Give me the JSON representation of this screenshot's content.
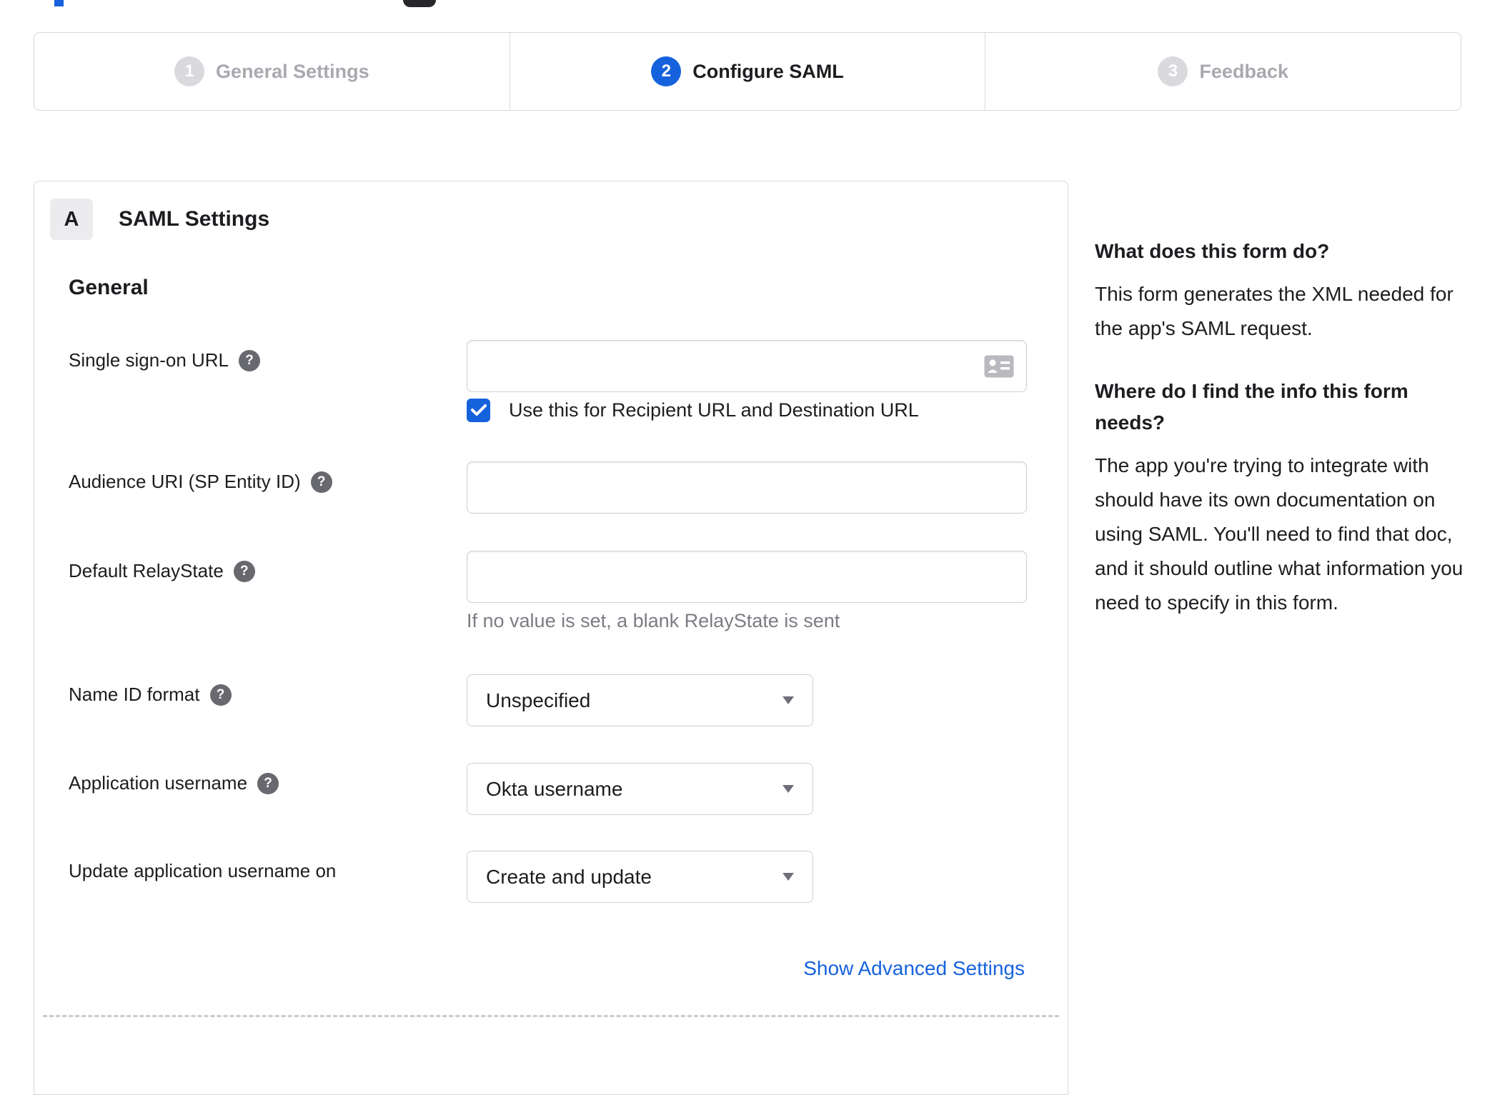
{
  "stepper": {
    "steps": [
      {
        "number": "1",
        "label": "General Settings",
        "state": "inactive"
      },
      {
        "number": "2",
        "label": "Configure SAML",
        "state": "active"
      },
      {
        "number": "3",
        "label": "Feedback",
        "state": "inactive"
      }
    ]
  },
  "form": {
    "badge": "A",
    "section_title": "SAML Settings",
    "group_title": "General",
    "fields": [
      {
        "label": "Single sign-on URL",
        "type": "text",
        "value": ""
      },
      {
        "label": "Audience URI (SP Entity ID)",
        "type": "text",
        "value": ""
      },
      {
        "label": "Default RelayState",
        "type": "text",
        "value": "",
        "hint": "If no value is set, a blank RelayState is sent"
      },
      {
        "label": "Name ID format",
        "type": "select",
        "value": "Unspecified"
      },
      {
        "label": "Application username",
        "type": "select",
        "value": "Okta username"
      },
      {
        "label": "Update application username on",
        "type": "select",
        "value": "Create and update"
      }
    ],
    "sso_checkbox": {
      "checked": true,
      "label": "Use this for Recipient URL and Destination URL"
    },
    "advanced_settings_link": "Show Advanced Settings"
  },
  "sidebar": {
    "sections": [
      {
        "heading": "What does this form do?",
        "body": "This form generates the XML needed for the app's SAML request."
      },
      {
        "heading": "Where do I find the info this form needs?",
        "body": "The app you're trying to integrate with should have its own documentation on using SAML. You'll need to find that doc, and it should outline what information you need to specify in this form."
      }
    ]
  },
  "colors": {
    "accent_blue": "#1662dd",
    "border_gray": "#d7d7dc",
    "text_dark": "#1d1d21",
    "muted_gray": "#7c7c84"
  }
}
